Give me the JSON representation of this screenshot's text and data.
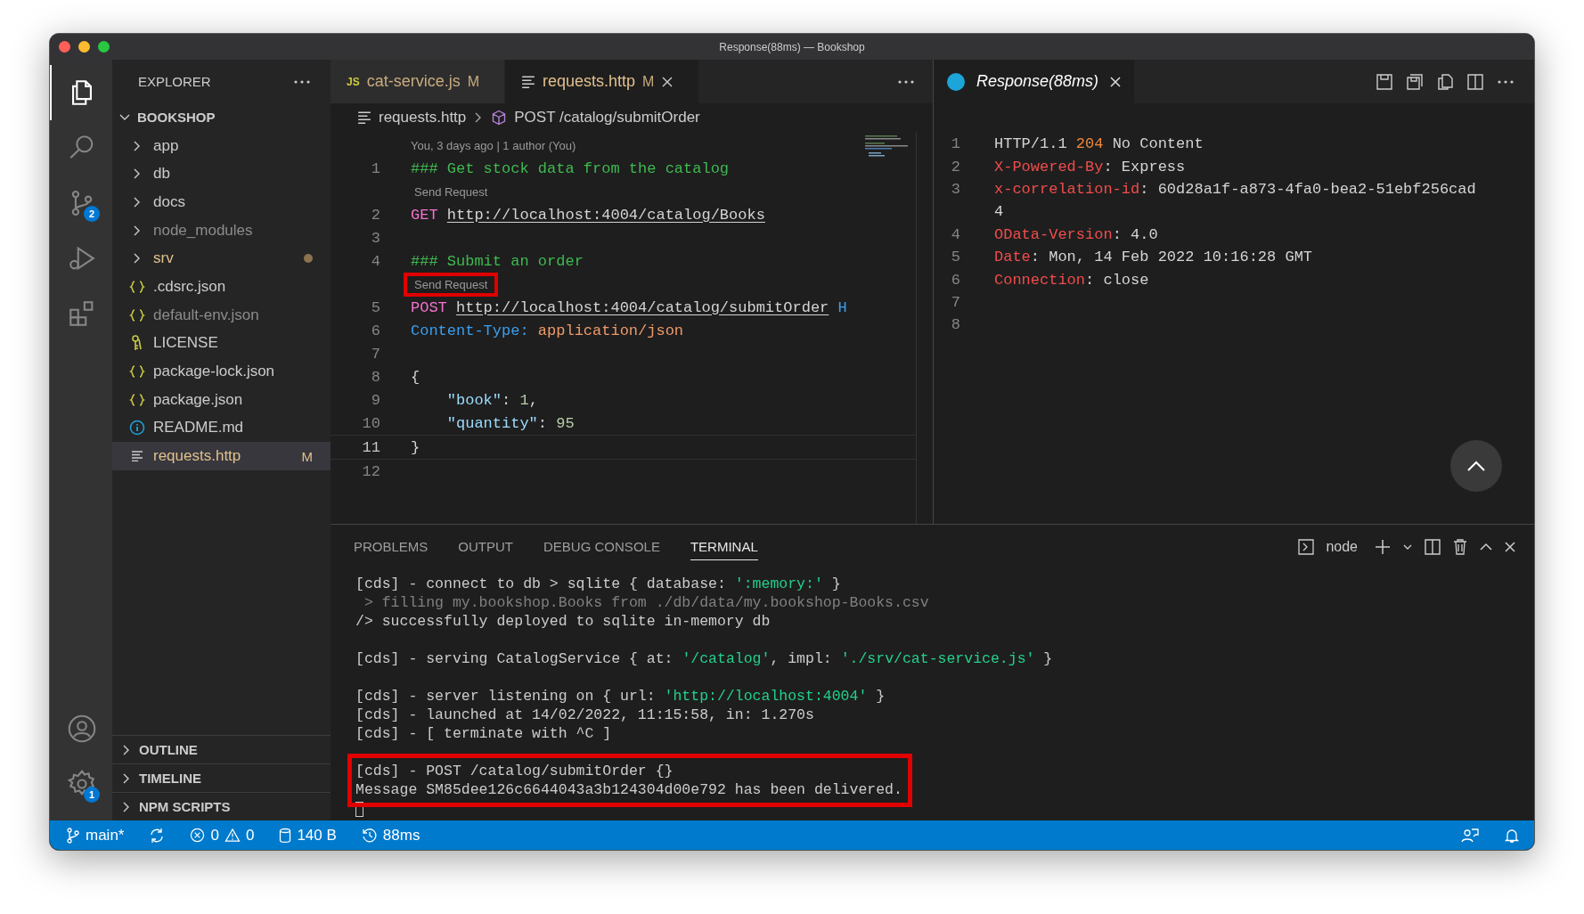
{
  "window": {
    "title": "Response(88ms) — Bookshop"
  },
  "activity_bar": {
    "items": [
      {
        "kind": "explorer",
        "selected": true
      },
      {
        "kind": "search",
        "selected": false
      },
      {
        "kind": "scm",
        "selected": false,
        "badge": "2"
      },
      {
        "kind": "debug",
        "selected": false
      },
      {
        "kind": "extensions",
        "selected": false
      }
    ],
    "bottom": [
      {
        "kind": "account"
      },
      {
        "kind": "settings",
        "badge": "1"
      }
    ]
  },
  "sidebar": {
    "title": "EXPLORER",
    "tree": [
      {
        "label": "BOOKSHOP",
        "expanded": true,
        "children": [
          {
            "label": "app",
            "kind": "folder",
            "expanded": false,
            "modified": false,
            "ignored": false,
            "dot": false,
            "selected": false
          },
          {
            "label": "db",
            "kind": "folder",
            "expanded": false,
            "modified": false,
            "ignored": false,
            "dot": false,
            "selected": false
          },
          {
            "label": "docs",
            "kind": "folder",
            "expanded": false,
            "modified": false,
            "ignored": false,
            "dot": false,
            "selected": false
          },
          {
            "label": "node_modules",
            "kind": "folder",
            "expanded": false,
            "modified": false,
            "ignored": true,
            "dot": false,
            "selected": false
          },
          {
            "label": "srv",
            "kind": "folder",
            "expanded": false,
            "modified": true,
            "ignored": false,
            "dot": true,
            "selected": false
          },
          {
            "label": ".cdsrc.json",
            "kind": "json",
            "modified": false,
            "ignored": false,
            "dot": false,
            "selected": false
          },
          {
            "label": "default-env.json",
            "kind": "json",
            "modified": false,
            "ignored": true,
            "dot": false,
            "selected": false
          },
          {
            "label": "LICENSE",
            "kind": "license",
            "modified": false,
            "ignored": false,
            "dot": false,
            "selected": false
          },
          {
            "label": "package-lock.json",
            "kind": "json",
            "modified": false,
            "ignored": false,
            "dot": false,
            "selected": false
          },
          {
            "label": "package.json",
            "kind": "json",
            "modified": false,
            "ignored": false,
            "dot": false,
            "selected": false
          },
          {
            "label": "README.md",
            "kind": "info",
            "modified": false,
            "ignored": false,
            "dot": false,
            "selected": false
          },
          {
            "label": "requests.http",
            "kind": "http",
            "modified": true,
            "ignored": false,
            "dot": false,
            "selected": true,
            "badge": "M"
          }
        ]
      }
    ],
    "sections": [
      {
        "label": "OUTLINE",
        "expanded": false
      },
      {
        "label": "TIMELINE",
        "expanded": false
      },
      {
        "label": "NPM SCRIPTS",
        "expanded": false
      }
    ]
  },
  "editor": {
    "tabs": [
      {
        "label": "cat-service.js",
        "kind": "js",
        "icon_label": "JS",
        "badge": "M",
        "selected": false
      },
      {
        "label": "requests.http",
        "kind": "http",
        "badge": "M",
        "selected": true
      }
    ],
    "breadcrumb": [
      "requests.http",
      "POST /catalog/submitOrder"
    ],
    "blame": "You, 3 days ago | 1 author (You)",
    "lines": [
      {
        "number": "1",
        "current": false,
        "tokens": [
          {
            "text": "### Get stock data from the catalog",
            "kind": "comment"
          }
        ]
      },
      {
        "number": "2",
        "current": false,
        "lens": "Send Request",
        "lens_highlighted": false,
        "tokens": [
          {
            "text": "GET ",
            "kind": "method"
          },
          {
            "text": "http://localhost:4004/catalog/Books",
            "kind": "url"
          }
        ]
      },
      {
        "number": "3",
        "current": false
      },
      {
        "number": "4",
        "current": false,
        "tokens": [
          {
            "text": "### Submit an order",
            "kind": "comment"
          }
        ]
      },
      {
        "number": "5",
        "current": false,
        "lens": "Send Request",
        "lens_highlighted": true,
        "tokens": [
          {
            "text": "POST ",
            "kind": "method"
          },
          {
            "text": "http://localhost:4004/catalog/submitOrder",
            "kind": "url"
          },
          {
            "text": " H",
            "kind": "header"
          }
        ]
      },
      {
        "number": "6",
        "current": false,
        "tokens": [
          {
            "text": "Content-Type:",
            "kind": "header"
          },
          {
            "text": " application/json",
            "kind": "value"
          }
        ]
      },
      {
        "number": "7",
        "current": false
      },
      {
        "number": "8",
        "current": false,
        "tokens": [
          {
            "text": "{",
            "kind": "plain"
          }
        ]
      },
      {
        "number": "9",
        "current": false,
        "tokens": [
          {
            "text": "    \"book\"",
            "kind": "key"
          },
          {
            "text": ": ",
            "kind": "plain"
          },
          {
            "text": "1",
            "kind": "number"
          },
          {
            "text": ",",
            "kind": "plain"
          }
        ]
      },
      {
        "number": "10",
        "current": false,
        "tokens": [
          {
            "text": "    \"quantity\"",
            "kind": "key"
          },
          {
            "text": ": ",
            "kind": "plain"
          },
          {
            "text": "95",
            "kind": "number"
          }
        ]
      },
      {
        "number": "11",
        "current": true,
        "tokens": [
          {
            "text": "}",
            "kind": "plain"
          }
        ]
      },
      {
        "number": "12",
        "current": false
      }
    ]
  },
  "response": {
    "tab": {
      "label": "Response(88ms)",
      "selected": true
    },
    "lines": [
      {
        "number": "1",
        "tokens": [
          {
            "text": "HTTP/1.1 ",
            "kind": "plain"
          },
          {
            "text": "204",
            "kind": "status"
          },
          {
            "text": " No Content",
            "kind": "plain"
          }
        ]
      },
      {
        "number": "2",
        "tokens": [
          {
            "text": "X-Powered-By",
            "kind": "name"
          },
          {
            "text": ": Express",
            "kind": "plain"
          }
        ]
      },
      {
        "number": "3",
        "tokens": [
          {
            "text": "x-correlation-id",
            "kind": "name"
          },
          {
            "text": ": 60d28a1f-a873-4fa0-bea2-51ebf256cad",
            "kind": "plain"
          }
        ]
      },
      {
        "tokens": [
          {
            "text": "4",
            "kind": "plain"
          }
        ]
      },
      {
        "number": "4",
        "tokens": [
          {
            "text": "OData-Version",
            "kind": "name"
          },
          {
            "text": ": 4.0",
            "kind": "plain"
          }
        ]
      },
      {
        "number": "5",
        "tokens": [
          {
            "text": "Date",
            "kind": "name"
          },
          {
            "text": ": Mon, 14 Feb 2022 10:16:28 GMT",
            "kind": "plain"
          }
        ]
      },
      {
        "number": "6",
        "tokens": [
          {
            "text": "Connection",
            "kind": "name"
          },
          {
            "text": ": close",
            "kind": "plain"
          }
        ]
      },
      {
        "number": "7"
      },
      {
        "number": "8"
      }
    ]
  },
  "panel": {
    "tabs": [
      {
        "label": "PROBLEMS",
        "selected": false
      },
      {
        "label": "OUTPUT",
        "selected": false
      },
      {
        "label": "DEBUG CONSOLE",
        "selected": false
      },
      {
        "label": "TERMINAL",
        "selected": true
      }
    ],
    "terminal_name": "node",
    "groups": [
      {
        "highlighted": false,
        "lines": [
          [
            {
              "text": "[cds] - connect to db > sqlite { database: ",
              "kind": "plain"
            },
            {
              "text": "':memory:'",
              "kind": "string"
            },
            {
              "text": " }",
              "kind": "plain"
            }
          ],
          [
            {
              "text": " > filling my.bookshop.Books from ./db/data/my.bookshop-Books.csv",
              "kind": "dim"
            }
          ],
          [
            {
              "text": "/> successfully deployed to sqlite in-memory db",
              "kind": "plain"
            }
          ]
        ]
      },
      {
        "highlighted": false,
        "lines": [
          [
            {
              "text": "[cds] - serving CatalogService { at: ",
              "kind": "plain"
            },
            {
              "text": "'/catalog'",
              "kind": "string"
            },
            {
              "text": ", impl: ",
              "kind": "plain"
            },
            {
              "text": "'./srv/cat-service.js'",
              "kind": "string"
            },
            {
              "text": " }",
              "kind": "plain"
            }
          ]
        ]
      },
      {
        "highlighted": false,
        "lines": [
          [
            {
              "text": "[cds] - server listening on { url: ",
              "kind": "plain"
            },
            {
              "text": "'http://localhost:4004'",
              "kind": "string"
            },
            {
              "text": " }",
              "kind": "plain"
            }
          ],
          [
            {
              "text": "[cds] - launched at 14/02/2022, 11:15:58, in: 1.270s",
              "kind": "plain"
            }
          ],
          [
            {
              "text": "[cds] - [ terminate with ^C ]",
              "kind": "plain"
            }
          ]
        ]
      },
      {
        "highlighted": true,
        "lines": [
          [
            {
              "text": "[cds] - POST /catalog/submitOrder {}",
              "kind": "plain"
            }
          ],
          [
            {
              "text": "Message SM85dee126c6644043a3b124304d00e792 has been delivered.",
              "kind": "plain"
            }
          ]
        ]
      }
    ]
  },
  "status_bar": {
    "branch": "main*",
    "errors": "0",
    "warnings": "0",
    "size": "140 B",
    "time": "88ms"
  }
}
